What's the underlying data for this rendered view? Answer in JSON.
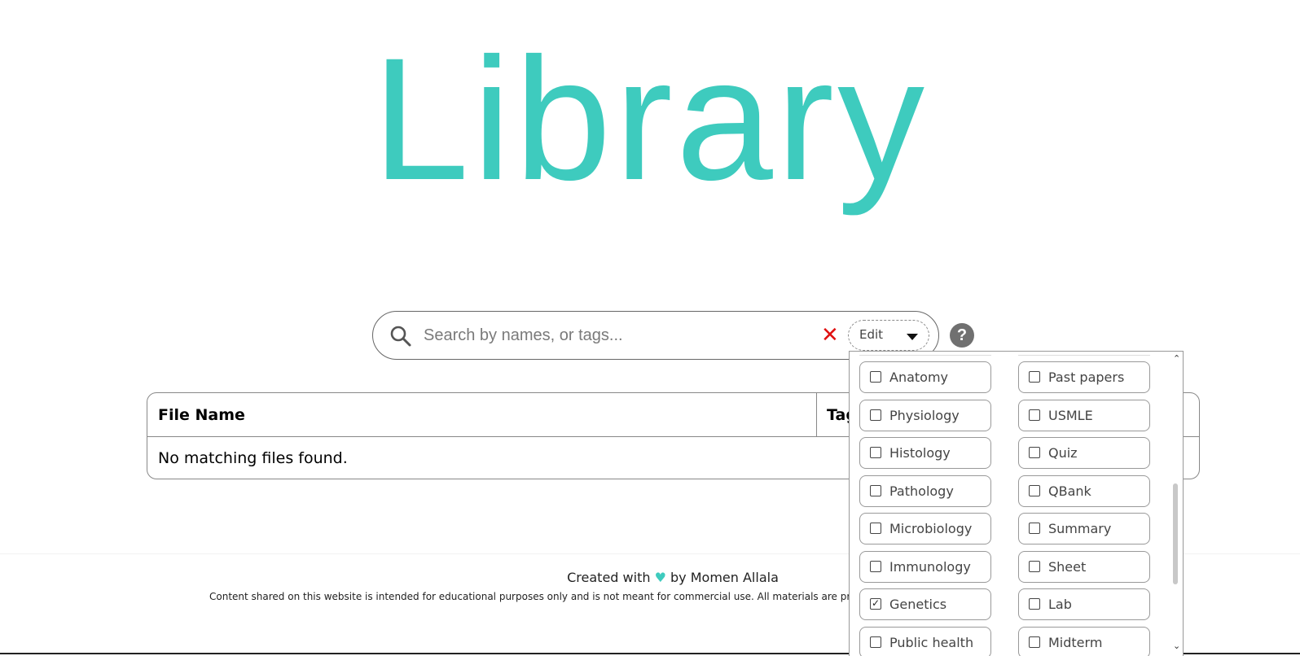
{
  "page": {
    "title": "Library"
  },
  "search": {
    "placeholder": "Search by names, or tags...",
    "value": "",
    "clear_symbol": "✕",
    "edit_label": "Edit"
  },
  "help": {
    "label": "?"
  },
  "table": {
    "columns": [
      "File Name",
      "Tags"
    ],
    "empty_message": "No matching files found."
  },
  "tag_options": [
    {
      "label": "Anatomy",
      "checked": false
    },
    {
      "label": "Past papers",
      "checked": false
    },
    {
      "label": "Physiology",
      "checked": false
    },
    {
      "label": "USMLE",
      "checked": false
    },
    {
      "label": "Histology",
      "checked": false
    },
    {
      "label": "Quiz",
      "checked": false
    },
    {
      "label": "Pathology",
      "checked": false
    },
    {
      "label": "QBank",
      "checked": false
    },
    {
      "label": "Microbiology",
      "checked": false
    },
    {
      "label": "Summary",
      "checked": false
    },
    {
      "label": "Immunology",
      "checked": false
    },
    {
      "label": "Sheet",
      "checked": false
    },
    {
      "label": "Genetics",
      "checked": true
    },
    {
      "label": "Lab",
      "checked": false
    },
    {
      "label": "Public health",
      "checked": false
    },
    {
      "label": "Midterm",
      "checked": false
    }
  ],
  "footer": {
    "credit_prefix": "Created with",
    "heart": "♥",
    "credit_suffix": "by Momen Allala",
    "disclaimer": "Content shared on this website is intended for educational purposes only and is not meant for commercial use. All materials are provided free"
  },
  "colors": {
    "accent": "#3ecbbe",
    "clear": "#e01010",
    "help": "#707070"
  },
  "icons": {
    "search": "search-icon",
    "clear": "close-icon",
    "caret": "caret-down-icon",
    "help": "help-icon",
    "heart": "heart-icon"
  }
}
